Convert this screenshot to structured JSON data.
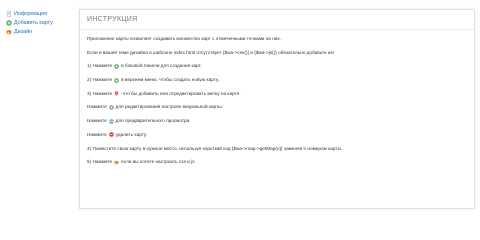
{
  "sidebar": {
    "items": [
      {
        "label": "Информация",
        "icon": "document-icon"
      },
      {
        "label": "Добавить карту",
        "icon": "plus-circle-icon"
      },
      {
        "label": "Дизайн",
        "icon": "palette-icon"
      }
    ]
  },
  "panel": {
    "title": "ИНСТРУКЦИЯ",
    "intro": "Приложение карты позволяет создавать множество карт с отмеченными точками на них.",
    "note": "Если в вашей теме дизайна в шаблоне index.html отсутствует {$wa->css()} и {$wa->js()} обязательно добавьте их!",
    "step1": {
      "before": "1) Нажмите",
      "after": "в боковой панели для создания карт."
    },
    "step2": {
      "before": "2) Нажмите",
      "after": "в верхнем меню, чтобы создать новую карту."
    },
    "step3": {
      "before": "3) Нажмите",
      "after": "-что бы добавить или отредактировать метку на карте."
    },
    "edit": {
      "before": "Нажмите",
      "after": "для редактирования настроек визуальной карты."
    },
    "preview": {
      "before": "Нажмите",
      "after": "для предварительного просмотра."
    },
    "delete": {
      "before": "Нажмите",
      "after": "удалить карту."
    },
    "step4": "4) Поместите свою карту в нужное место, используя короткий код {$wa->map->getMap(n)} заменяя n номером карты.",
    "step5": {
      "before": "5) Нажмите",
      "after": "если вы хотите настроить css и js."
    }
  },
  "colors": {
    "link": "#2a6fb8",
    "add_green": "#4caf50",
    "delete_red": "#d9362b",
    "marker_red": "#e53935",
    "gear_gray": "#9e9e9e",
    "preview_blue": "#5b9bd5",
    "palette_orange": "#e8a23a"
  }
}
